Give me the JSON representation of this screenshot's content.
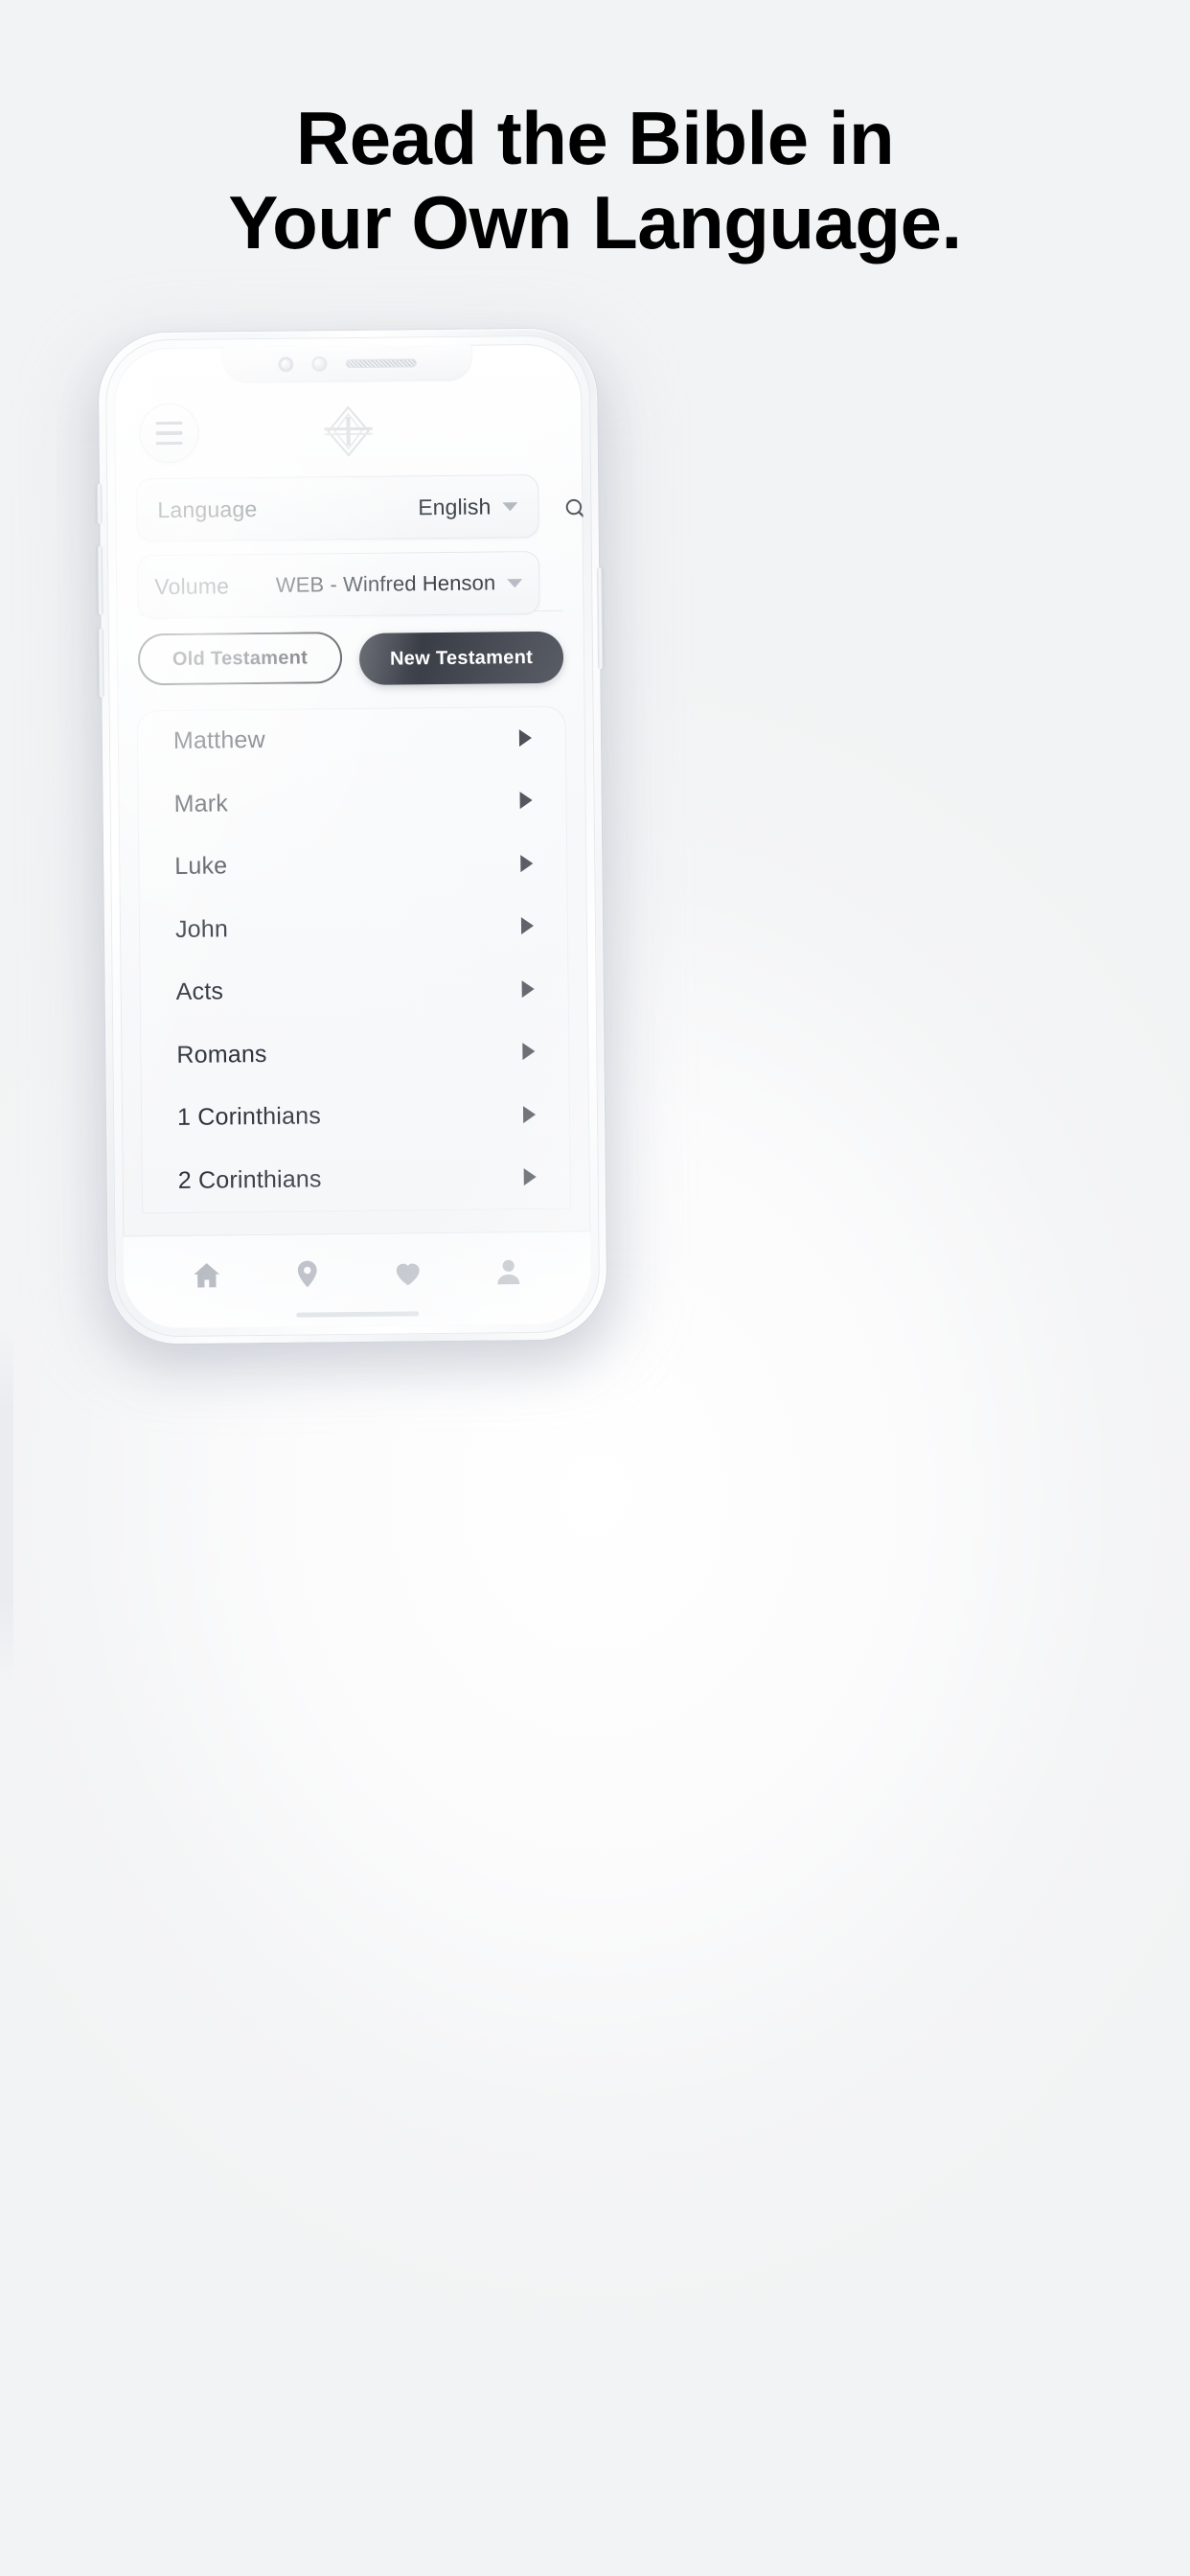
{
  "headline": {
    "line1": "Read the Bible in",
    "line2": "Your Own Language."
  },
  "phone": {
    "header": {
      "menu_icon": "hamburger-menu-icon",
      "logo_icon": "brand-diamond-logo"
    },
    "selectors": [
      {
        "label": "Language",
        "value": "English",
        "caret": "chevron-down-icon"
      },
      {
        "label": "Volume",
        "value": "WEB - Winfred Henson",
        "caret": "chevron-down-icon"
      }
    ],
    "search_icon": "search-icon",
    "testaments": [
      {
        "label": "Old Testament",
        "selected": false
      },
      {
        "label": "New Testament",
        "selected": true
      }
    ],
    "books": [
      "Matthew",
      "Mark",
      "Luke",
      "John",
      "Acts",
      "Romans",
      "1 Corinthians",
      "2 Corinthians"
    ],
    "bottom_nav": [
      {
        "icon": "home-icon",
        "active": false
      },
      {
        "icon": "location-pin-icon",
        "active": false
      },
      {
        "icon": "heart-icon",
        "active": false
      },
      {
        "icon": "person-icon",
        "active": false
      }
    ]
  },
  "colors": {
    "page_bg": "#ffffff",
    "headline": "#000000",
    "accent_dark": "#393d46",
    "book_text": "#2c3039",
    "label_text": "#4b5058",
    "nav_icon": "#b4b8bf"
  }
}
